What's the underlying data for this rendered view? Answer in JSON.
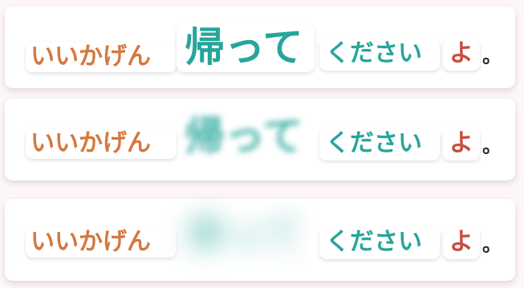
{
  "rows": [
    {
      "segments": [
        "いいかげん",
        "帰って",
        "ください",
        "よ"
      ],
      "period": "。",
      "hidden_state": "visible"
    },
    {
      "segments": [
        "いいかげん",
        "帰って",
        "ください",
        "よ"
      ],
      "period": "。",
      "hidden_state": "slightly-blurred"
    },
    {
      "segments": [
        "いいかげん",
        "帰って",
        "ください",
        "よ"
      ],
      "period": "。",
      "hidden_state": "heavily-blurred"
    }
  ],
  "colors": {
    "segment1": "#d4783f",
    "segment2": "#26a69a",
    "segment3": "#26a69a",
    "segment4": "#c84e3f",
    "period": "#1e2a36"
  }
}
